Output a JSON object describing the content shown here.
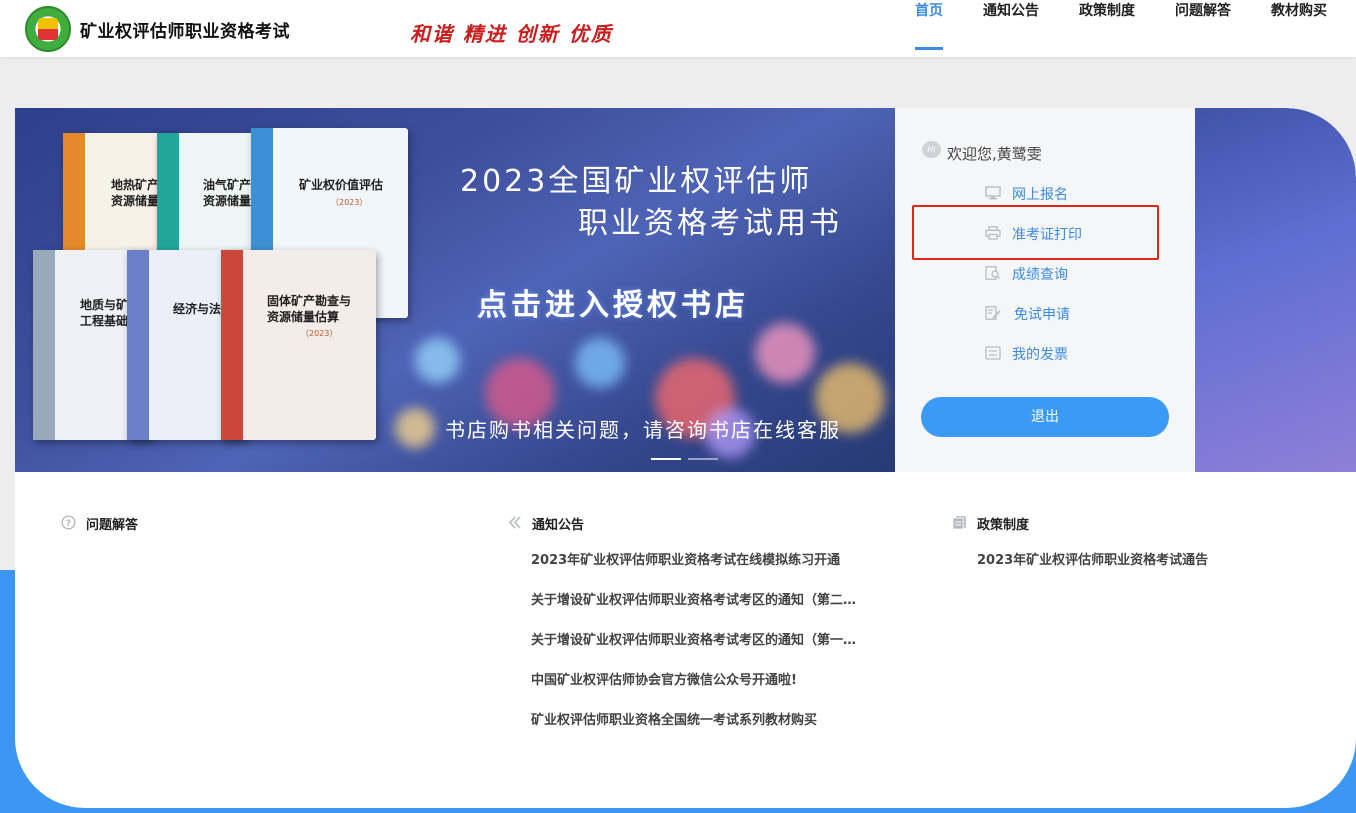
{
  "header": {
    "site_title": "矿业权评估师职业资格考试",
    "slogan": "和谐 精进 创新 优质",
    "nav": [
      {
        "label": "首页",
        "active": true
      },
      {
        "label": "通知公告",
        "active": false
      },
      {
        "label": "政策制度",
        "active": false
      },
      {
        "label": "问题解答",
        "active": false
      },
      {
        "label": "教材购买",
        "active": false
      }
    ]
  },
  "banner": {
    "headline_line1": "2023全国矿业权评估师",
    "headline_line2": "职业资格考试用书",
    "cta": "点击进入授权书店",
    "note": "书店购书相关问题，请咨询书店在线客服",
    "books": [
      {
        "title_line1": "地热矿产",
        "title_line2": "资源储量"
      },
      {
        "title_line1": "油气矿产",
        "title_line2": "资源储量"
      },
      {
        "title_line1": "矿业权价值评估",
        "title_line2": "",
        "year": "（2023）"
      },
      {
        "title_line1": "地质与矿",
        "title_line2": "工程基础"
      },
      {
        "title_line1": "经济与法",
        "title_line2": ""
      },
      {
        "title_line1": "固体矿产勘查与",
        "title_line2": "资源储量估算",
        "year": "（2023）"
      }
    ]
  },
  "panel": {
    "welcome_badge": "Hi",
    "welcome": "欢迎您,黄鹭雯",
    "menu": [
      {
        "label": "网上报名",
        "icon": "monitor-icon"
      },
      {
        "label": "准考证打印",
        "icon": "printer-icon"
      },
      {
        "label": "成绩查询",
        "icon": "search-document-icon"
      },
      {
        "label": "免试申请",
        "icon": "edit-document-icon"
      },
      {
        "label": "我的发票",
        "icon": "invoice-icon"
      }
    ],
    "logout": "退出"
  },
  "columns": {
    "faq": {
      "title": "问题解答",
      "items": []
    },
    "notices": {
      "title": "通知公告",
      "items": [
        "2023年矿业权评估师职业资格考试在线模拟练习开通",
        "关于增设矿业权评估师职业资格考试考区的通知（第二…",
        "关于增设矿业权评估师职业资格考试考区的通知（第一…",
        "中国矿业权评估师协会官方微信公众号开通啦!",
        "矿业权评估师职业资格全国统一考试系列教材购买"
      ]
    },
    "policy": {
      "title": "政策制度",
      "items": [
        "2023年矿业权评估师职业资格考试通告"
      ]
    }
  },
  "colors": {
    "accent": "#3d8be0",
    "button": "#3b9af5",
    "highlight": "#e1251b",
    "slogan": "#c81e1e",
    "swoosh": "#3d97f2"
  }
}
